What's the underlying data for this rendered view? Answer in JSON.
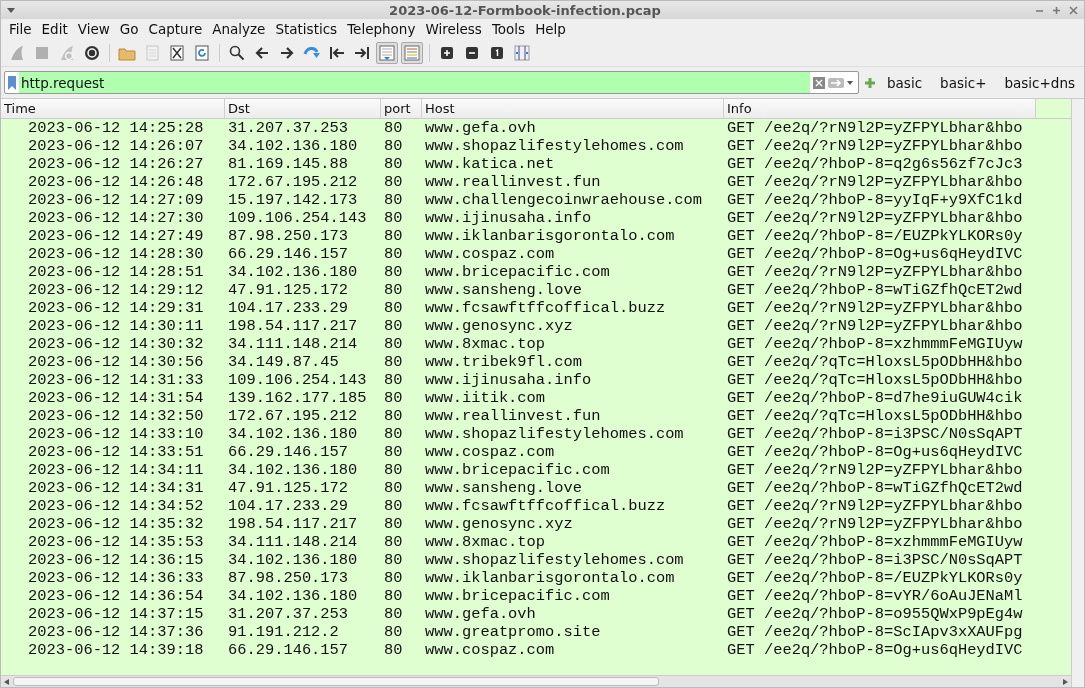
{
  "window": {
    "title": "2023-06-12-Formbook-infection.pcap"
  },
  "menu": [
    "File",
    "Edit",
    "View",
    "Go",
    "Capture",
    "Analyze",
    "Statistics",
    "Telephony",
    "Wireless",
    "Tools",
    "Help"
  ],
  "toolbar": [
    {
      "kind": "fin",
      "disabled": true,
      "on": false
    },
    {
      "kind": "stop",
      "disabled": true,
      "on": false
    },
    {
      "kind": "restart",
      "disabled": true,
      "on": false
    },
    {
      "kind": "options",
      "disabled": false,
      "on": false
    },
    {
      "kind": "sep"
    },
    {
      "kind": "open",
      "disabled": false,
      "on": false
    },
    {
      "kind": "file",
      "disabled": true,
      "on": false
    },
    {
      "kind": "close",
      "disabled": false,
      "on": false
    },
    {
      "kind": "reload",
      "disabled": false,
      "on": false
    },
    {
      "kind": "sep"
    },
    {
      "kind": "find",
      "disabled": false,
      "on": false
    },
    {
      "kind": "back",
      "disabled": false,
      "on": false
    },
    {
      "kind": "forward",
      "disabled": false,
      "on": false
    },
    {
      "kind": "goto",
      "disabled": false,
      "on": false
    },
    {
      "kind": "first",
      "disabled": false,
      "on": false
    },
    {
      "kind": "last",
      "disabled": false,
      "on": false
    },
    {
      "kind": "autoscroll",
      "disabled": false,
      "on": true
    },
    {
      "kind": "colorize",
      "disabled": false,
      "on": true
    },
    {
      "kind": "sep"
    },
    {
      "kind": "zoomin",
      "disabled": false,
      "on": false
    },
    {
      "kind": "zoomout",
      "disabled": false,
      "on": false
    },
    {
      "kind": "zoomreset",
      "disabled": false,
      "on": false
    },
    {
      "kind": "resize",
      "disabled": false,
      "on": false
    }
  ],
  "filter": {
    "value": "http.request"
  },
  "filter_buttons": [
    "basic",
    "basic+",
    "basic+dns"
  ],
  "table": {
    "columns": [
      "Time",
      "Dst",
      "port",
      "Host",
      "Info"
    ],
    "rows": [
      [
        "2023-06-12 14:25:28",
        "31.207.37.253",
        "80",
        "www.gefa.ovh",
        "GET /ee2q/?rN9l2P=yZFPYLbhar&hbo"
      ],
      [
        "2023-06-12 14:26:07",
        "34.102.136.180",
        "80",
        "www.shopazlifestylehomes.com",
        "GET /ee2q/?rN9l2P=yZFPYLbhar&hbo"
      ],
      [
        "2023-06-12 14:26:27",
        "81.169.145.88",
        "80",
        "www.katica.net",
        "GET /ee2q/?hboP-8=q2g6s56zf7cJc3"
      ],
      [
        "2023-06-12 14:26:48",
        "172.67.195.212",
        "80",
        "www.reallinvest.fun",
        "GET /ee2q/?rN9l2P=yZFPYLbhar&hbo"
      ],
      [
        "2023-06-12 14:27:09",
        "15.197.142.173",
        "80",
        "www.challengecoinwraehouse.com",
        "GET /ee2q/?hboP-8=yyIqF+y9XfC1kd"
      ],
      [
        "2023-06-12 14:27:30",
        "109.106.254.143",
        "80",
        "www.ijinusaha.info",
        "GET /ee2q/?rN9l2P=yZFPYLbhar&hbo"
      ],
      [
        "2023-06-12 14:27:49",
        "87.98.250.173",
        "80",
        "www.iklanbarisgorontalo.com",
        "GET /ee2q/?hboP-8=/EUZPkYLKORs0y"
      ],
      [
        "2023-06-12 14:28:30",
        "66.29.146.157",
        "80",
        "www.cospaz.com",
        "GET /ee2q/?hboP-8=Og+us6qHeydIVC"
      ],
      [
        "2023-06-12 14:28:51",
        "34.102.136.180",
        "80",
        "www.bricepacific.com",
        "GET /ee2q/?rN9l2P=yZFPYLbhar&hbo"
      ],
      [
        "2023-06-12 14:29:12",
        "47.91.125.172",
        "80",
        "www.sansheng.love",
        "GET /ee2q/?hboP-8=wTiGZfhQcET2wd"
      ],
      [
        "2023-06-12 14:29:31",
        "104.17.233.29",
        "80",
        "www.fcsawftffcoffical.buzz",
        "GET /ee2q/?rN9l2P=yZFPYLbhar&hbo"
      ],
      [
        "2023-06-12 14:30:11",
        "198.54.117.217",
        "80",
        "www.genosync.xyz",
        "GET /ee2q/?rN9l2P=yZFPYLbhar&hbo"
      ],
      [
        "2023-06-12 14:30:32",
        "34.111.148.214",
        "80",
        "www.8xmac.top",
        "GET /ee2q/?hboP-8=xzhmmmFeMGIUyw"
      ],
      [
        "2023-06-12 14:30:56",
        "34.149.87.45",
        "80",
        "www.tribek9fl.com",
        "GET /ee2q/?qTc=HloxsL5pODbHH&hbo"
      ],
      [
        "2023-06-12 14:31:33",
        "109.106.254.143",
        "80",
        "www.ijinusaha.info",
        "GET /ee2q/?qTc=HloxsL5pODbHH&hbo"
      ],
      [
        "2023-06-12 14:31:54",
        "139.162.177.185",
        "80",
        "www.iitik.com",
        "GET /ee2q/?hboP-8=d7he9iuGUW4cik"
      ],
      [
        "2023-06-12 14:32:50",
        "172.67.195.212",
        "80",
        "www.reallinvest.fun",
        "GET /ee2q/?qTc=HloxsL5pODbHH&hbo"
      ],
      [
        "2023-06-12 14:33:10",
        "34.102.136.180",
        "80",
        "www.shopazlifestylehomes.com",
        "GET /ee2q/?hboP-8=i3PSC/N0sSqAPT"
      ],
      [
        "2023-06-12 14:33:51",
        "66.29.146.157",
        "80",
        "www.cospaz.com",
        "GET /ee2q/?hboP-8=Og+us6qHeydIVC"
      ],
      [
        "2023-06-12 14:34:11",
        "34.102.136.180",
        "80",
        "www.bricepacific.com",
        "GET /ee2q/?rN9l2P=yZFPYLbhar&hbo"
      ],
      [
        "2023-06-12 14:34:31",
        "47.91.125.172",
        "80",
        "www.sansheng.love",
        "GET /ee2q/?hboP-8=wTiGZfhQcET2wd"
      ],
      [
        "2023-06-12 14:34:52",
        "104.17.233.29",
        "80",
        "www.fcsawftffcoffical.buzz",
        "GET /ee2q/?rN9l2P=yZFPYLbhar&hbo"
      ],
      [
        "2023-06-12 14:35:32",
        "198.54.117.217",
        "80",
        "www.genosync.xyz",
        "GET /ee2q/?rN9l2P=yZFPYLbhar&hbo"
      ],
      [
        "2023-06-12 14:35:53",
        "34.111.148.214",
        "80",
        "www.8xmac.top",
        "GET /ee2q/?hboP-8=xzhmmmFeMGIUyw"
      ],
      [
        "2023-06-12 14:36:15",
        "34.102.136.180",
        "80",
        "www.shopazlifestylehomes.com",
        "GET /ee2q/?hboP-8=i3PSC/N0sSqAPT"
      ],
      [
        "2023-06-12 14:36:33",
        "87.98.250.173",
        "80",
        "www.iklanbarisgorontalo.com",
        "GET /ee2q/?hboP-8=/EUZPkYLKORs0y"
      ],
      [
        "2023-06-12 14:36:54",
        "34.102.136.180",
        "80",
        "www.bricepacific.com",
        "GET /ee2q/?hboP-8=vYR/6oAuJENaMl"
      ],
      [
        "2023-06-12 14:37:15",
        "31.207.37.253",
        "80",
        "www.gefa.ovh",
        "GET /ee2q/?hboP-8=o955QWxP9pEg4w"
      ],
      [
        "2023-06-12 14:37:36",
        "91.191.212.2",
        "80",
        "www.greatpromo.site",
        "GET /ee2q/?hboP-8=ScIApv3xXAUFpg"
      ],
      [
        "2023-06-12 14:39:18",
        "66.29.146.157",
        "80",
        "www.cospaz.com",
        "GET /ee2q/?hboP-8=Og+us6qHeydIVC"
      ]
    ]
  }
}
